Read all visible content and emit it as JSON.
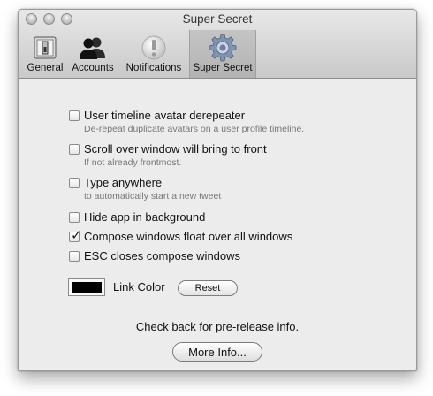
{
  "window": {
    "title": "Super Secret"
  },
  "toolbar": {
    "items": [
      {
        "label": "General",
        "icon": "switch-icon",
        "selected": false
      },
      {
        "label": "Accounts",
        "icon": "people-icon",
        "selected": false
      },
      {
        "label": "Notifications",
        "icon": "alert-icon",
        "selected": false
      },
      {
        "label": "Super Secret",
        "icon": "gear-icon",
        "selected": true
      }
    ]
  },
  "options": [
    {
      "label": "User timeline avatar derepeater",
      "sub": "De-repeat duplicate avatars on a user profile timeline.",
      "checked": false
    },
    {
      "label": "Scroll over window will bring to front",
      "sub": "If not already frontmost.",
      "checked": false
    },
    {
      "label": "Type anywhere",
      "sub": "to automatically start a new tweet",
      "checked": false
    },
    {
      "label": "Hide app in background",
      "sub": "",
      "checked": false
    },
    {
      "label": "Compose windows float over all windows",
      "sub": "",
      "checked": true
    },
    {
      "label": "ESC closes compose windows",
      "sub": "",
      "checked": false
    }
  ],
  "link_color": {
    "label": "Link Color",
    "value": "#000000",
    "reset_label": "Reset"
  },
  "info": {
    "text": "Check back for pre-release info.",
    "button_label": "More Info..."
  },
  "colors": {
    "window_bg": "#ececec",
    "subtext": "#777777"
  }
}
